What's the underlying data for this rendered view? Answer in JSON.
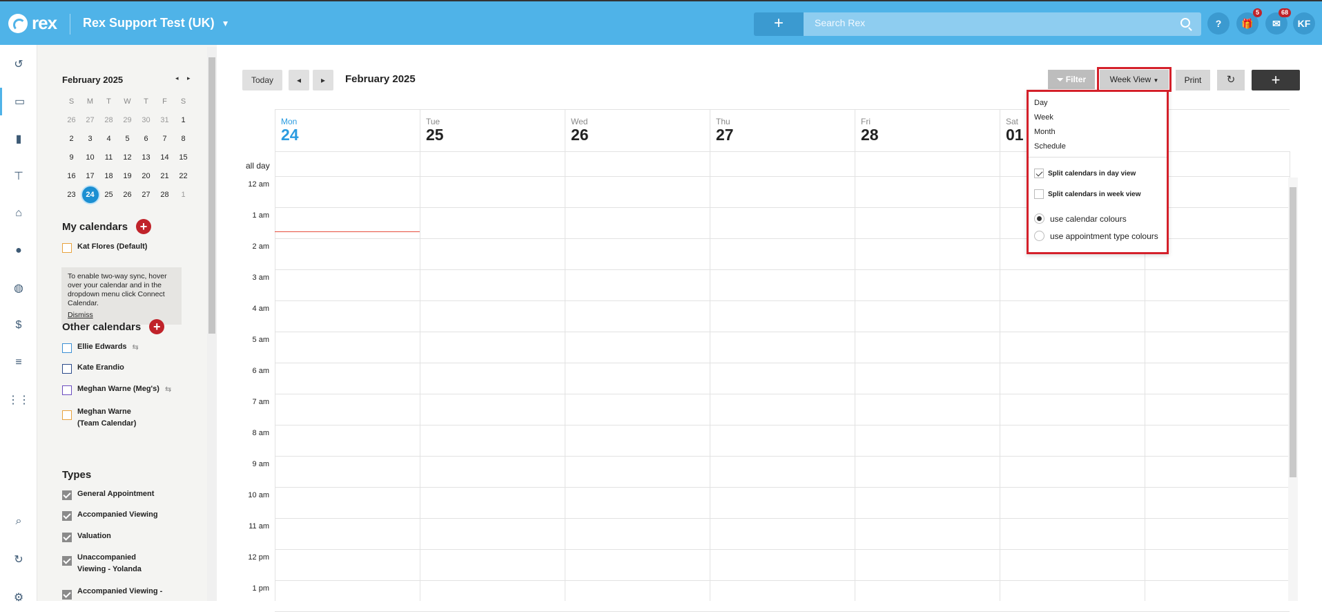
{
  "topbar": {
    "logo_text": "rex",
    "account_name": "Rex Support Test (UK)",
    "add_label": "+",
    "search_placeholder": "Search Rex",
    "help_label": "?",
    "gift_badge": "5",
    "inbox_badge": "68",
    "user_initials": "KF"
  },
  "mini_calendar": {
    "title": "February 2025",
    "prev": "◂",
    "next": "▸",
    "weekdays": [
      "S",
      "M",
      "T",
      "W",
      "T",
      "F",
      "S"
    ],
    "weeks": [
      [
        "26",
        "27",
        "28",
        "29",
        "30",
        "31",
        "1"
      ],
      [
        "2",
        "3",
        "4",
        "5",
        "6",
        "7",
        "8"
      ],
      [
        "9",
        "10",
        "11",
        "12",
        "13",
        "14",
        "15"
      ],
      [
        "16",
        "17",
        "18",
        "19",
        "20",
        "21",
        "22"
      ],
      [
        "23",
        "24",
        "25",
        "26",
        "27",
        "28",
        "1"
      ]
    ]
  },
  "my_calendars": {
    "title": "My calendars",
    "items": [
      {
        "label": "Kat Flores (Default)",
        "color": "#e8a33d"
      }
    ]
  },
  "sync_notice": {
    "text": "To enable two-way sync, hover over your calendar and in the dropdown menu click Connect Calendar.",
    "dismiss": "Dismiss"
  },
  "other_calendars": {
    "title": "Other calendars",
    "items": [
      {
        "label": "Ellie Edwards",
        "color": "#3b8fd4"
      },
      {
        "label": "Kate Erandio",
        "color": "#2a4a8a"
      },
      {
        "label": "Meghan Warne (Meg's)",
        "color": "#6a4bbf"
      },
      {
        "label": "Meghan Warne (Team Calendar)",
        "color": "#e8a33d"
      }
    ]
  },
  "types": {
    "title": "Types",
    "items": [
      "General Appointment",
      "Accompanied Viewing",
      "Valuation",
      "Unaccompanied Viewing - Yolanda",
      "Accompanied Viewing -"
    ]
  },
  "toolbar": {
    "today": "Today",
    "prev": "◂",
    "next": "▸",
    "title": "February 2025",
    "filter": "Filter",
    "week_view": "Week View",
    "print": "Print",
    "refresh": "↻",
    "new": "+"
  },
  "week": {
    "days": [
      {
        "name": "Mon",
        "date": "24"
      },
      {
        "name": "Tue",
        "date": "25"
      },
      {
        "name": "Wed",
        "date": "26"
      },
      {
        "name": "Thu",
        "date": "27"
      },
      {
        "name": "Fri",
        "date": "28"
      },
      {
        "name": "Sat",
        "date": "01"
      },
      {
        "name": "",
        "date": ""
      }
    ],
    "all_day": "all day",
    "hours": [
      "12 am",
      "1 am",
      "2 am",
      "3 am",
      "4 am",
      "5 am",
      "6 am",
      "7 am",
      "8 am",
      "9 am",
      "10 am",
      "11 am",
      "12 pm",
      "1 pm"
    ]
  },
  "view_menu": {
    "views": [
      "Day",
      "Week",
      "Month",
      "Schedule"
    ],
    "split_day": "Split calendars in day view",
    "split_week": "Split calendars in week view",
    "calendar_colours": "use calendar colours",
    "appointment_colours": "use appointment type colours"
  }
}
